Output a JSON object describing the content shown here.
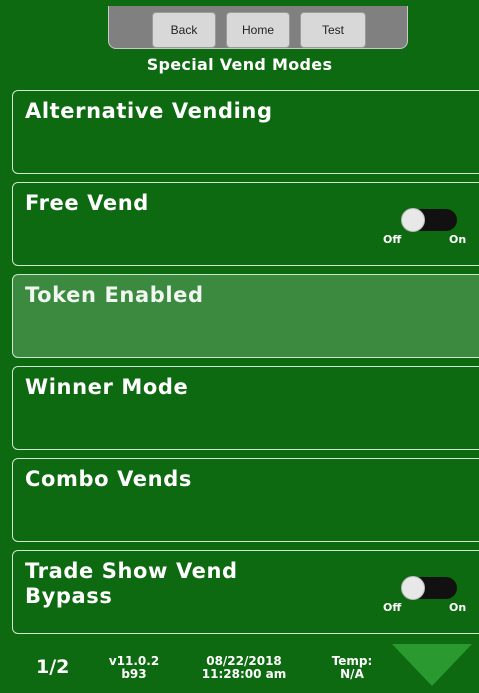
{
  "header": {
    "buttons": {
      "back": "Back",
      "home": "Home",
      "test": "Test"
    },
    "title": "Special Vend Modes"
  },
  "menu": [
    {
      "label": "Alternative Vending",
      "toggle": null,
      "selected": false
    },
    {
      "label": "Free Vend",
      "toggle": {
        "off": "Off",
        "on": "On",
        "state": "off"
      },
      "selected": false
    },
    {
      "label": "Token Enabled",
      "toggle": null,
      "selected": true
    },
    {
      "label": "Winner Mode",
      "toggle": null,
      "selected": false
    },
    {
      "label": "Combo Vends",
      "toggle": null,
      "selected": false
    },
    {
      "label": "Trade Show Vend\nBypass",
      "toggle": {
        "off": "Off",
        "on": "On",
        "state": "off"
      },
      "selected": false
    }
  ],
  "status": {
    "page": "1/2",
    "version_line1": "v11.0.2",
    "version_line2": "b93",
    "date": "08/22/2018",
    "time": "11:28:00 am",
    "temp_label": "Temp:",
    "temp_value": "N/A"
  },
  "colors": {
    "background": "#0e6a10",
    "selected_item": "#3b8a40",
    "arrow": "#2a9a30"
  },
  "icons": {
    "next_page": "triangle-down-icon"
  }
}
